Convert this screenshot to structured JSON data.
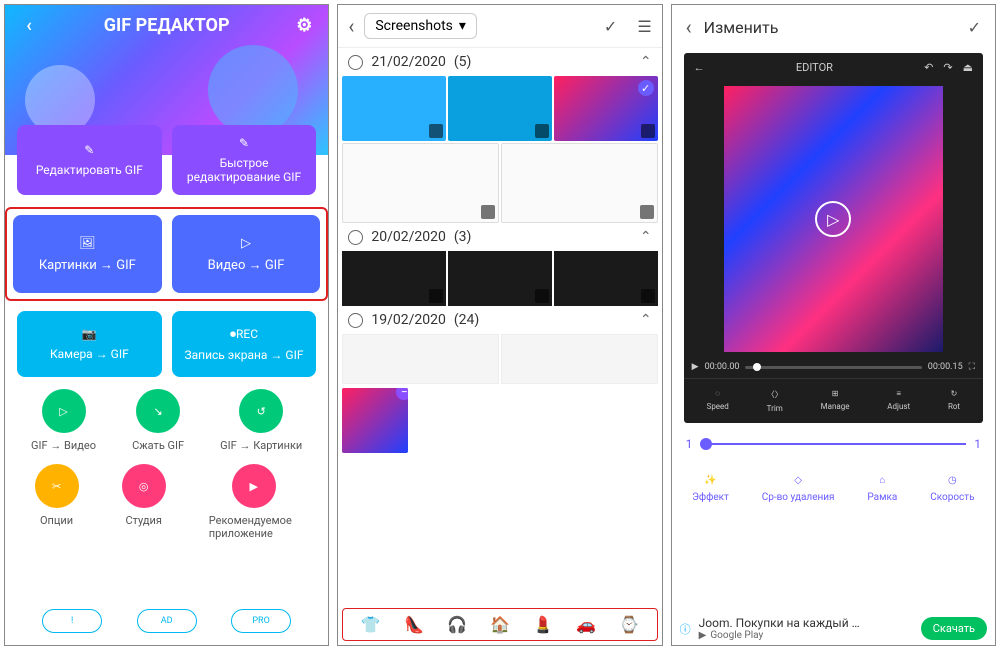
{
  "screen1": {
    "title": "GIF РЕДАКТОР",
    "cards": {
      "edit_gif": "Редактировать GIF",
      "quick_edit": "Быстрое редактирование GIF",
      "pics_gif": "Картинки → GIF",
      "video_gif": "Видео → GIF",
      "camera_gif": "Камера → GIF",
      "screen_gif": "Запись экрана → GIF"
    },
    "circles": {
      "gif_video": "GIF → Видео",
      "compress": "Сжать GIF",
      "gif_pics": "GIF → Картинки",
      "options": "Опции",
      "studio": "Студия",
      "recommended": "Рекомендуемое приложение"
    },
    "pills": {
      "info": "!",
      "ad": "AD",
      "pro": "PRO"
    }
  },
  "screen2": {
    "folder": "Screenshots",
    "groups": [
      {
        "date": "21/02/2020",
        "count": "(5)"
      },
      {
        "date": "20/02/2020",
        "count": "(3)"
      },
      {
        "date": "19/02/2020",
        "count": "(24)"
      }
    ],
    "emoji_bar": [
      "👕",
      "👠",
      "🎧",
      "🏠",
      "💄",
      "🚗",
      "⌚"
    ]
  },
  "screen3": {
    "title": "Изменить",
    "editor_label": "EDITOR",
    "time_start": "00:00.00",
    "time_end": "00:00.15",
    "ed_tools": [
      "Speed",
      "Trim",
      "Manage",
      "Adjust",
      "Rot"
    ],
    "slider_min": "1",
    "slider_max": "1",
    "tools": [
      "Эффект",
      "Ср-во удаления",
      "Рамка",
      "Скорость"
    ],
    "ad_title": "Joom. Покупки на каждый …",
    "ad_store": "Google Play",
    "ad_btn": "Скачать"
  }
}
